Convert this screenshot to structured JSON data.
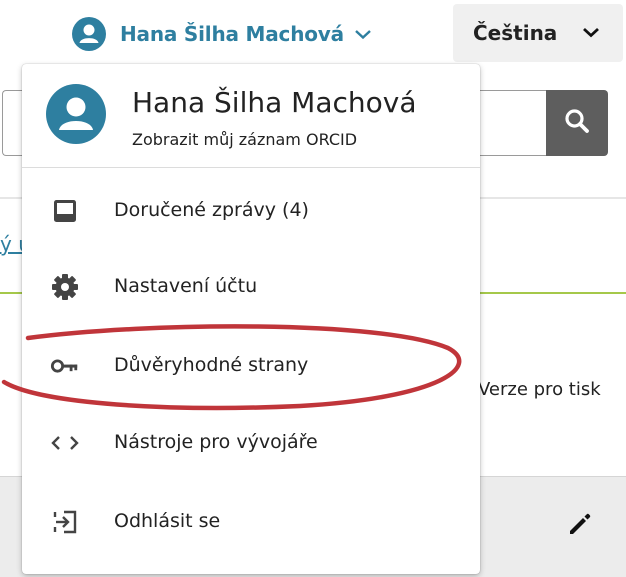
{
  "header": {
    "user_name": "Hana Šilha Machová",
    "language_label": "Čeština"
  },
  "background": {
    "link_fragment": "ý ú",
    "print_link": "Verze pro tisk"
  },
  "dropdown": {
    "name": "Hana Šilha Machová",
    "profile_link": "Zobrazit můj záznam ORCID",
    "items": [
      {
        "label": "Doručené zprávy (4)",
        "icon": "inbox-icon"
      },
      {
        "label": "Nastavení účtu",
        "icon": "gear-icon"
      },
      {
        "label": "Důvěryhodné strany",
        "icon": "key-icon"
      },
      {
        "label": "Nástroje pro vývojáře",
        "icon": "code-icon"
      },
      {
        "label": "Odhlásit se",
        "icon": "logout-icon"
      }
    ]
  },
  "colors": {
    "accent": "#2e7fa0",
    "annotation": "#c0353a",
    "divider_green": "#a5c84a",
    "search_button": "#5e5e5e"
  }
}
